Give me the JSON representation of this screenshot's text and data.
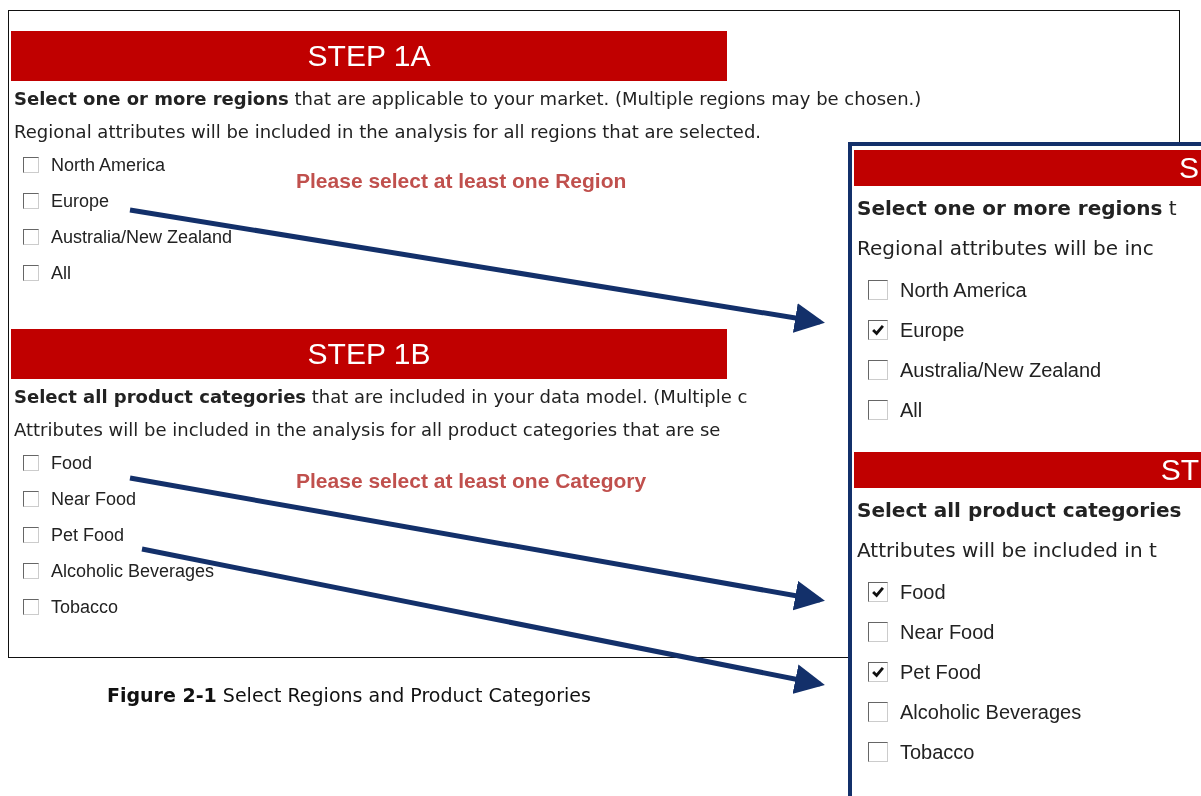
{
  "original_panel": {
    "sections": [
      {
        "heading": "STEP 1A",
        "instruction": "**Select one or more regions** that are applicable to your market. (Multiple regions may be chosen.)",
        "note": "Regional attributes will be included in the analysis for all regions that are selected.",
        "warning": "Please select at least one Region",
        "options": [
          {
            "label": "North America",
            "checked": false
          },
          {
            "label": "Europe",
            "checked": false
          },
          {
            "label": "Australia/New Zealand",
            "checked": false
          },
          {
            "label": "All",
            "checked": false
          }
        ]
      },
      {
        "heading": "STEP 1B",
        "instruction": "**Select all product categories** that are included in your data model. (Multiple c",
        "note": "Attributes will be included in the analysis for all product categories that are se",
        "warning": "Please select at least one Category",
        "options": [
          {
            "label": "Food",
            "checked": false
          },
          {
            "label": "Near Food",
            "checked": false
          },
          {
            "label": "Pet Food",
            "checked": false
          },
          {
            "label": "Alcoholic Beverages",
            "checked": false
          },
          {
            "label": "Tobacco",
            "checked": false
          }
        ]
      }
    ]
  },
  "zoomed_panel": {
    "sections": [
      {
        "heading": "S",
        "instruction": "**Select one or more regions** t",
        "note": "Regional attributes will be inc",
        "options": [
          {
            "label": "North America",
            "checked": false
          },
          {
            "label": "Europe",
            "checked": true
          },
          {
            "label": "Australia/New Zealand",
            "checked": false
          },
          {
            "label": "All",
            "checked": false
          }
        ]
      },
      {
        "heading": "ST",
        "instruction": "**Select all product categories**",
        "note": "Attributes will be included in t",
        "options": [
          {
            "label": "Food",
            "checked": true
          },
          {
            "label": "Near Food",
            "checked": false
          },
          {
            "label": "Pet Food",
            "checked": true
          },
          {
            "label": "Alcoholic Beverages",
            "checked": false
          },
          {
            "label": "Tobacco",
            "checked": false
          }
        ]
      }
    ]
  },
  "caption": "**Figure 2-1** Select Regions and Product Categories"
}
